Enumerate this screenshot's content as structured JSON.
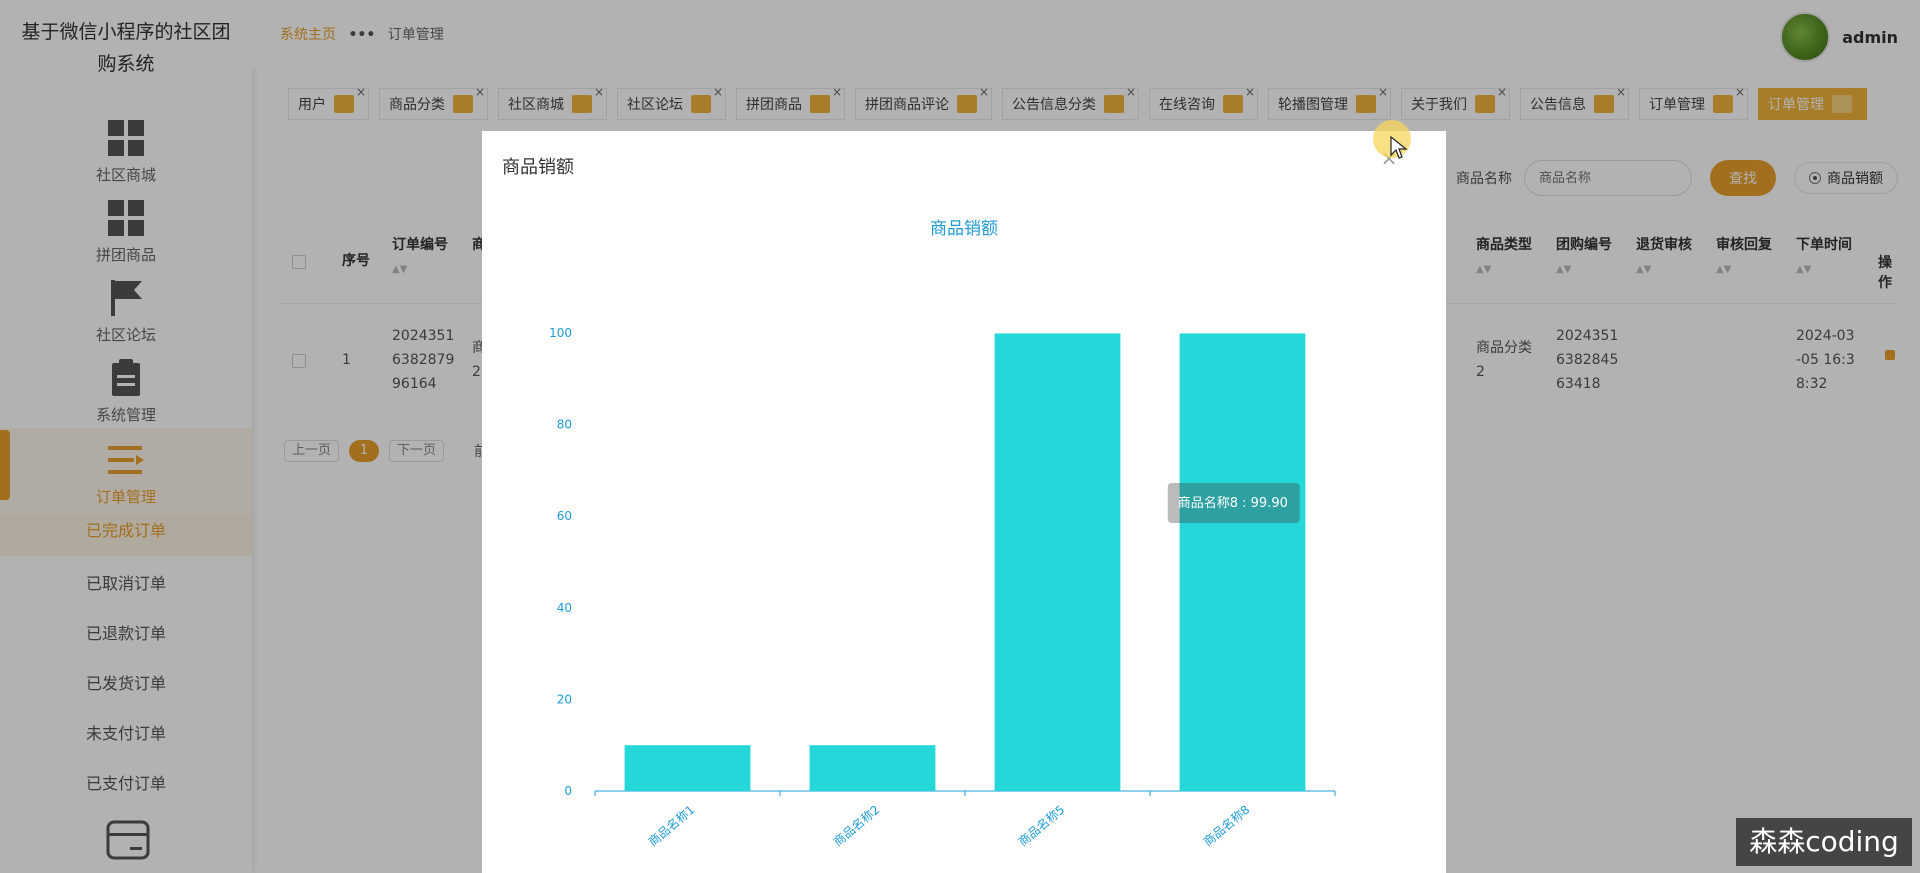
{
  "app": {
    "title_line1": "基于微信小程序的社区团",
    "title_line2": "购系统"
  },
  "sidebar": {
    "items": [
      {
        "label": "社区商城",
        "icon": "grid-icon"
      },
      {
        "label": "拼团商品",
        "icon": "grid-icon"
      },
      {
        "label": "社区论坛",
        "icon": "flag-icon"
      },
      {
        "label": "系统管理",
        "icon": "clipboard-icon"
      },
      {
        "label": "订单管理",
        "icon": "list-icon"
      }
    ],
    "sub_items": [
      "已完成订单",
      "已取消订单",
      "已退款订单",
      "已发货订单",
      "未支付订单",
      "已支付订单"
    ],
    "bottom_icon": "card-icon"
  },
  "header": {
    "breadcrumb_home": "系统主页",
    "breadcrumb_current": "订单管理",
    "username": "admin"
  },
  "tabs": [
    {
      "label": "用户"
    },
    {
      "label": "商品分类"
    },
    {
      "label": "社区商城"
    },
    {
      "label": "社区论坛"
    },
    {
      "label": "拼团商品"
    },
    {
      "label": "拼团商品评论"
    },
    {
      "label": "公告信息分类"
    },
    {
      "label": "在线咨询"
    },
    {
      "label": "轮播图管理"
    },
    {
      "label": "关于我们"
    },
    {
      "label": "公告信息"
    },
    {
      "label": "订单管理"
    },
    {
      "label": "订单管理"
    }
  ],
  "search": {
    "label": "商品名称",
    "placeholder": "商品名称",
    "button": "查找",
    "radio_label": "商品销额"
  },
  "table": {
    "headers": [
      "序号",
      "订单编号",
      "商",
      "商品类型",
      "团购编号",
      "退货审核",
      "审核回复",
      "下单时间",
      "操作"
    ],
    "row": {
      "index": "1",
      "order_no": [
        "2024351",
        "6382879",
        "96164"
      ],
      "partial": [
        "商",
        "2"
      ],
      "type": [
        "商品分类",
        "2"
      ],
      "group_no": [
        "2024351",
        "6382845",
        "63418"
      ],
      "time": [
        "2024-03",
        "-05 16:3",
        "8:32"
      ]
    }
  },
  "pager": {
    "prev": "上一页",
    "current": "1",
    "next": "下一页",
    "goto": "前往"
  },
  "modal": {
    "title": "商品销额",
    "close": "×"
  },
  "chart_data": {
    "type": "bar",
    "title": "商品销额",
    "categories": [
      "商品名称1",
      "商品名称2",
      "商品名称5",
      "商品名称8"
    ],
    "values": [
      10,
      10,
      99.9,
      99.9
    ],
    "ylim": [
      0,
      100
    ],
    "yticks": [
      0,
      20,
      40,
      60,
      80,
      100
    ],
    "tooltip": "商品名称8 : 99.90",
    "bar_color": "#26d7d9",
    "axis_color": "#1e9bd7"
  },
  "watermark": "森森coding"
}
